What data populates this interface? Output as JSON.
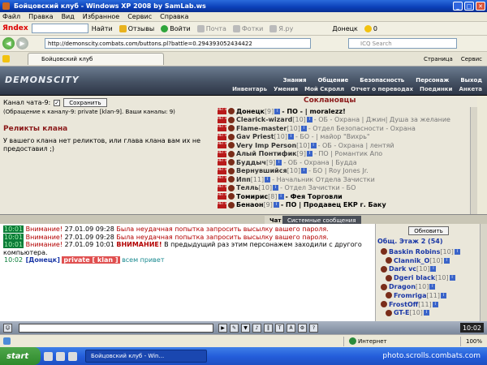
{
  "window": {
    "title": "Бойцовский клуб - Windows XP 2008 by SamLab.ws"
  },
  "menu": [
    "Файл",
    "Правка",
    "Вид",
    "Избранное",
    "Сервис",
    "Справка"
  ],
  "yandex": {
    "logo": "Яndex",
    "items": [
      "Найти",
      "Отзывы",
      "Войти",
      "Почта",
      "Фотки",
      "Я.ру",
      "Донецк",
      "0"
    ]
  },
  "address": {
    "url": "http://demonscity.combats.com/buttons.pl?battle=0.294393052434422",
    "search_placeholder": "ICQ Search"
  },
  "tab": {
    "title": "Бойцовский клуб",
    "tools": [
      "Страница",
      "Сервис"
    ]
  },
  "game": {
    "logo": "DEMONSCITY",
    "menu1": [
      "Знания",
      "Общение",
      "Безопасность",
      "Персонаж",
      "Выход"
    ],
    "menu2": [
      "Инвентарь",
      "Умения",
      "Мой Скролл",
      "Отчет о переводах",
      "Поединки",
      "Анкета"
    ]
  },
  "channel": {
    "label": "Канал чата-9:",
    "checkmark": "✓",
    "save": "Сохранить",
    "hint": "(Обращение к каналу-9: private [klan-9]. Ваши каналы: 9)"
  },
  "relics": {
    "title": "Реликты клана",
    "text": "У вашего клана нет реликтов, или глава клана вам их не предоставил ;)"
  },
  "members": {
    "title": "Соклановцы",
    "list": [
      {
        "name": "Донецк",
        "level": "[9]",
        "title": "- ПО - | moralezz!",
        "online": true
      },
      {
        "name": "Clearick-wizard",
        "level": "[10]",
        "title": "- ОБ - Охрана | Джин| Душа за желание",
        "online": false
      },
      {
        "name": "Flame-master",
        "level": "[10]",
        "title": "- Отдел Безопасности - Охрана",
        "online": false
      },
      {
        "name": "Gav Priest",
        "level": "[10]",
        "title": "- БО - | майор \"Вихрь\"",
        "online": false
      },
      {
        "name": "Very Imp Person",
        "level": "[10]",
        "title": "- ОБ - Охрана | лентяй",
        "online": false
      },
      {
        "name": "Алый Понтифик",
        "level": "[9]",
        "title": "- ПО | Романтик Апо",
        "online": false
      },
      {
        "name": "Буддыч",
        "level": "[9]",
        "title": "- ОБ - Охрана | Будда",
        "online": false
      },
      {
        "name": "Вернувшийся",
        "level": "[10]",
        "title": "- БО | Roy Jones Jr.",
        "online": false
      },
      {
        "name": "Ипп",
        "level": "[11]",
        "title": "- Начальник Отдела Зачистки",
        "online": false
      },
      {
        "name": "Телль",
        "level": "[10]",
        "title": "- Отдел Зачистки - БО",
        "online": false
      },
      {
        "name": "Томирис",
        "level": "[8]",
        "title": "- Фея Торговли",
        "online": true
      },
      {
        "name": "Бенаон",
        "level": "[9]",
        "title": "- ПО | Продавец ЕКР г. Баку",
        "online": true
      }
    ]
  },
  "chat": {
    "tabs": [
      "Чат",
      "Системные сообщения"
    ],
    "messages": [
      {
        "time": "10:01",
        "warn": "Внимание!",
        "date": "27.01.09 09:28",
        "text": "Была неудачная попытка запросить высылку вашего пароля."
      },
      {
        "time": "10:01",
        "warn": "Внимание!",
        "date": "27.01.09 09:28",
        "text": "Была неудачная попытка запросить высылку вашего пароля."
      },
      {
        "time": "10:01",
        "warn": "Внимание!",
        "date": "27.01.09 10:01",
        "text": "ВНИМАНИЕ!",
        "extra": "В предыдущий раз этим персонажем заходили с другого компьютера."
      },
      {
        "time": "10:02",
        "from": "[Донецк]",
        "priv": "private [ klan ]",
        "text": "всем привет"
      }
    ]
  },
  "online": {
    "refresh": "Обновить",
    "title": "Общ. Этаж 2 (54)",
    "list": [
      {
        "name": "Baskin Robins",
        "level": "[10]"
      },
      {
        "name": "Clannik_O",
        "level": "[10]"
      },
      {
        "name": "Dark vc",
        "level": "[10]"
      },
      {
        "name": "Dgeri black",
        "level": "[10]"
      },
      {
        "name": "Dragon",
        "level": "[10]"
      },
      {
        "name": "Fromriga",
        "level": "[11]"
      },
      {
        "name": "FrostOff",
        "level": "[11]"
      },
      {
        "name": "GT-E",
        "level": "[10]"
      }
    ]
  },
  "inputbar": {
    "clock": "10:02"
  },
  "status": {
    "zone": "Интернет",
    "zoom": "100%"
  },
  "taskbar": {
    "start": "start",
    "task": "Бойцовский клуб - Win...",
    "watermark": "photo.scrolls.combats.com"
  },
  "colors": {
    "accent": "#8b1a1a",
    "link": "#1a37a6",
    "warning": "#b30000",
    "time": "#0a7d38"
  }
}
